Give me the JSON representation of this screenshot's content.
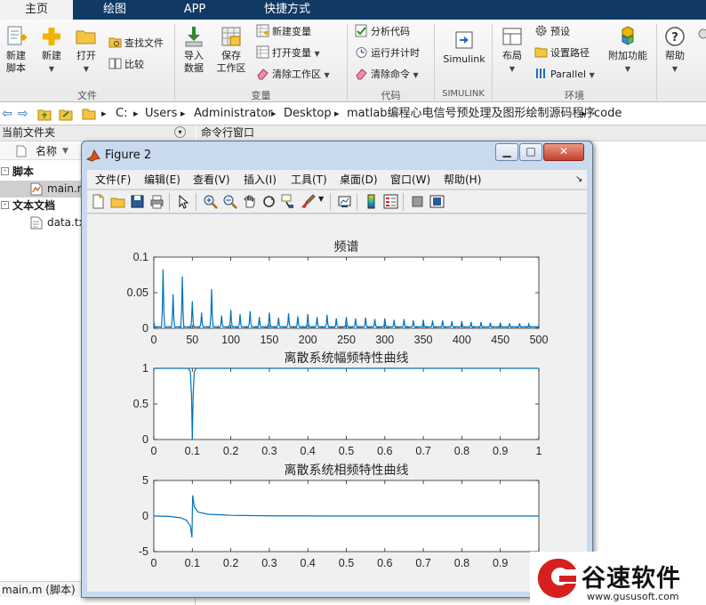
{
  "ribbon_tabs": [
    "主页",
    "绘图",
    "APP",
    "快捷方式"
  ],
  "ribbon": {
    "file_group": {
      "label": "文件",
      "new_script": "新建\n脚本",
      "new": "新建",
      "open": "打开",
      "find_files": "查找文件",
      "compare": "比较"
    },
    "variable_group": {
      "label": "变量",
      "import_data": "导入\n数据",
      "save_workspace": "保存\n工作区",
      "new_variable": "新建变量",
      "open_variable": "打开变量",
      "clear_workspace": "清除工作区"
    },
    "code_group": {
      "label": "代码",
      "analyze_code": "分析代码",
      "run_and_time": "运行并计时",
      "clear_commands": "清除命令"
    },
    "simulink_group": {
      "label": "SIMULINK",
      "simulink": "Simulink"
    },
    "environment_group": {
      "label": "环境",
      "layout": "布局",
      "preferences": "预设",
      "set_path": "设置路径",
      "parallel": "Parallel",
      "addons": "附加功能"
    },
    "help": "帮助"
  },
  "address_bar": {
    "path": [
      "C:",
      "Users",
      "Administrator",
      "Desktop",
      "matlab编程心电信号预处理及图形绘制源码程序",
      "code"
    ]
  },
  "current_folder": {
    "title": "当前文件夹",
    "column_name": "名称",
    "sections": [
      {
        "label": "脚本",
        "items": [
          "main.m"
        ]
      },
      {
        "label": "文本文档",
        "items": [
          "data.txt"
        ]
      }
    ],
    "status": "main.m  (脚本)"
  },
  "command_window": {
    "title": "命令行窗口"
  },
  "figure": {
    "title": "Figure 2",
    "menu": [
      "文件(F)",
      "编辑(E)",
      "查看(V)",
      "插入(I)",
      "工具(T)",
      "桌面(D)",
      "窗口(W)",
      "帮助(H)"
    ],
    "toolbar_icons": [
      "new-figure-icon",
      "open-file-icon",
      "save-icon",
      "print-icon",
      "arrow-select-icon",
      "zoom-in-icon",
      "zoom-out-icon",
      "pan-hand-icon",
      "rotate3d-icon",
      "data-cursor-icon",
      "brush-icon",
      "link-plot-icon",
      "colorbar-icon",
      "legend-icon",
      "hide-plot-tools-icon",
      "show-plot-tools-icon"
    ]
  },
  "chart_data": [
    {
      "type": "line",
      "title": "频谱",
      "xlim": [
        0,
        500
      ],
      "ylim": [
        0,
        0.1
      ],
      "xticks": [
        0,
        50,
        100,
        150,
        200,
        250,
        300,
        350,
        400,
        450,
        500
      ],
      "yticks": [
        0,
        0.05,
        0.1
      ],
      "xtick_labels": [
        "0",
        "50",
        "100",
        "150",
        "200",
        "250",
        "300",
        "350",
        "400",
        "450",
        "500"
      ],
      "ytick_labels": [
        "0",
        "0.05",
        "0.1"
      ],
      "peaks": {
        "x": [
          12,
          25,
          37,
          50,
          62,
          75,
          88,
          100,
          112,
          125,
          137,
          150,
          162,
          175,
          187,
          200,
          212,
          225,
          237,
          250,
          262,
          275,
          287,
          300,
          312,
          325,
          337,
          350,
          362,
          375,
          387,
          400,
          412,
          425,
          437,
          450,
          462,
          475,
          487
        ],
        "y": [
          0.083,
          0.048,
          0.073,
          0.038,
          0.022,
          0.055,
          0.018,
          0.026,
          0.02,
          0.024,
          0.016,
          0.022,
          0.015,
          0.021,
          0.017,
          0.02,
          0.016,
          0.019,
          0.014,
          0.016,
          0.014,
          0.015,
          0.013,
          0.014,
          0.012,
          0.013,
          0.011,
          0.012,
          0.011,
          0.011,
          0.01,
          0.01,
          0.009,
          0.009,
          0.008,
          0.008,
          0.007,
          0.007,
          0.006
        ]
      },
      "series_color": "#0072bd"
    },
    {
      "type": "line",
      "title": "离散系统幅频特性曲线",
      "xlim": [
        0,
        1
      ],
      "ylim": [
        0,
        1
      ],
      "xticks": [
        0,
        0.1,
        0.2,
        0.3,
        0.4,
        0.5,
        0.6,
        0.7,
        0.8,
        0.9,
        1
      ],
      "yticks": [
        0,
        0.5,
        1
      ],
      "xtick_labels": [
        "0",
        "0.1",
        "0.2",
        "0.3",
        "0.4",
        "0.5",
        "0.6",
        "0.7",
        "0.8",
        "0.9",
        "1"
      ],
      "ytick_labels": [
        "0",
        "0.5",
        "1"
      ],
      "x": [
        0,
        0.09,
        0.095,
        0.098,
        0.1,
        0.102,
        0.105,
        0.11,
        1
      ],
      "y": [
        1,
        1,
        0.95,
        0.6,
        0.0,
        0.6,
        0.95,
        1,
        1
      ],
      "series_color": "#0072bd"
    },
    {
      "type": "line",
      "title": "离散系统相频特性曲线",
      "xlim": [
        0,
        1
      ],
      "ylim": [
        -5,
        5
      ],
      "xticks": [
        0,
        0.1,
        0.2,
        0.3,
        0.4,
        0.5,
        0.6,
        0.7,
        0.8,
        0.9,
        1
      ],
      "yticks": [
        -5,
        0,
        5
      ],
      "xtick_labels": [
        "0",
        "0.1",
        "0.2",
        "0.3",
        "0.4",
        "0.5",
        "0.6",
        "0.7",
        "0.8",
        "0.9",
        "1"
      ],
      "ytick_labels": [
        "-5",
        "0",
        "5"
      ],
      "x": [
        0,
        0.04,
        0.07,
        0.085,
        0.095,
        0.099,
        0.1,
        0.101,
        0.105,
        0.115,
        0.14,
        0.2,
        0.3,
        0.5,
        1
      ],
      "y": [
        0,
        -0.05,
        -0.25,
        -0.6,
        -1.4,
        -3.0,
        0.2,
        2.9,
        1.3,
        0.55,
        0.25,
        0.1,
        0.03,
        0.0,
        0.0
      ],
      "series_color": "#0072bd"
    }
  ],
  "watermark": {
    "brand": "谷速软件",
    "url": "www.gususoft.com"
  },
  "colors": {
    "ribbon_tab_bg": "#103a64",
    "plot_line": "#0072bd",
    "figure_frame": "#c9d9ee"
  }
}
